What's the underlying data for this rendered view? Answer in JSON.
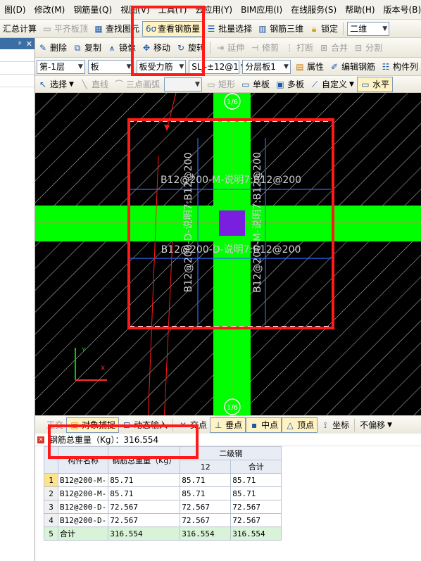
{
  "menu": [
    "图(D)",
    "修改(M)",
    "钢筋量(Q)",
    "视图(V)",
    "工具(T)",
    "云应用(Y)",
    "BIM应用(I)",
    "在线服务(S)",
    "帮助(H)",
    "版本号(B)"
  ],
  "toolbar1": {
    "summary": "汇总计算",
    "align_slab": "平齐板顶",
    "find_element": "查找图元",
    "view_rebar": "查看钢筋量",
    "batch_select": "批量选择",
    "rebar_3d": "钢筋三维",
    "lock": "锁定",
    "view_mode": "二维"
  },
  "toolbar2": {
    "delete": "删除",
    "copy": "复制",
    "mirror": "镜像",
    "move": "移动",
    "rotate": "旋转",
    "extend": "延伸",
    "trim": "修剪",
    "break": "打断",
    "merge": "合并",
    "split": "分割"
  },
  "toolbar3": {
    "floor": "第-1层",
    "category": "板",
    "subtype": "板受力筋",
    "element": "SLJ-±12@1",
    "layer": "分层板1",
    "properties": "属性",
    "edit_rebar": "编辑钢筋",
    "component_list": "构件列"
  },
  "toolbar4": {
    "select": "选择",
    "line": "直线",
    "arc": "三点画弧",
    "rect": "矩形",
    "single_slab": "单板",
    "multi_slab": "多板",
    "custom": "自定义",
    "horizontal": "水平"
  },
  "canvas": {
    "axis_top": "1/6",
    "axis_bottom": "1/6",
    "label_top": "B12@200-M-说明7:B12@200",
    "label_bottom": "B12@200-D-说明7:B12@200",
    "label_left_vertical": "B12@200-D-说明7:B12@200",
    "label_right_vertical": "B12@200-M-说明7:B12@200",
    "colors": {
      "background": "#000000",
      "beam": "#00ff00",
      "column": "#7a1fe0",
      "rebar": "#2b6bff",
      "annotation": "#ff1a1a"
    }
  },
  "snapbar": {
    "intersect": "交点",
    "perpendicular": "垂点",
    "midpoint": "中点",
    "vertex": "顶点",
    "coordinate": "坐标",
    "offset_mode": "不偏移",
    "hidden_left": "正交",
    "hidden_mid": "对象捕捉",
    "hidden_right": "动态输入"
  },
  "rebar_panel": {
    "title": "钢筋总重量（Kg）：316.554",
    "headers": {
      "name": "构件名称",
      "total": "钢筋总重量（Kg）",
      "grade": "二级钢",
      "diameter": "12",
      "subtotal": "合计"
    },
    "rows": [
      {
        "no": "1",
        "name": "B12@200-M-",
        "total": "85.71",
        "d12": "85.71",
        "sum": "85.71"
      },
      {
        "no": "2",
        "name": "B12@200-M-",
        "total": "85.71",
        "d12": "85.71",
        "sum": "85.71"
      },
      {
        "no": "3",
        "name": "B12@200-D-",
        "total": "72.567",
        "d12": "72.567",
        "sum": "72.567"
      },
      {
        "no": "4",
        "name": "B12@200-D-",
        "total": "72.567",
        "d12": "72.567",
        "sum": "72.567"
      },
      {
        "no": "5",
        "name": "合计",
        "total": "316.554",
        "d12": "316.554",
        "sum": "316.554"
      }
    ]
  }
}
